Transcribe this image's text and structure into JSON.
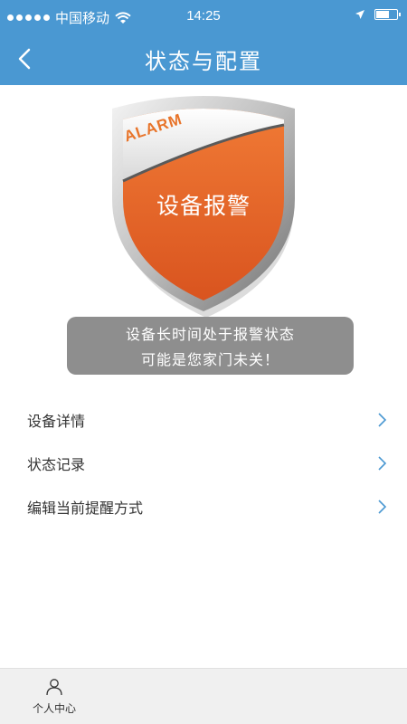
{
  "status_bar": {
    "carrier": "中国移动",
    "time": "14:25"
  },
  "nav": {
    "title": "状态与配置",
    "back_icon": "chevron-left-icon"
  },
  "badge": {
    "alarm_text": "ALARM",
    "label": "设备报警",
    "colors": {
      "shield": "#e8642a",
      "silver": "#c9c9c9"
    }
  },
  "alert": {
    "line1": "设备长时间处于报警状态",
    "line2": "可能是您家门未关！"
  },
  "menu": {
    "items": [
      {
        "label": "设备详情"
      },
      {
        "label": "状态记录"
      },
      {
        "label": "编辑当前提醒方式"
      }
    ]
  },
  "tab_bar": {
    "items": [
      {
        "label": "个人中心",
        "icon": "person-icon"
      }
    ]
  },
  "colors": {
    "accent": "#4a98d2",
    "alert_bg": "#8e8e8e"
  }
}
